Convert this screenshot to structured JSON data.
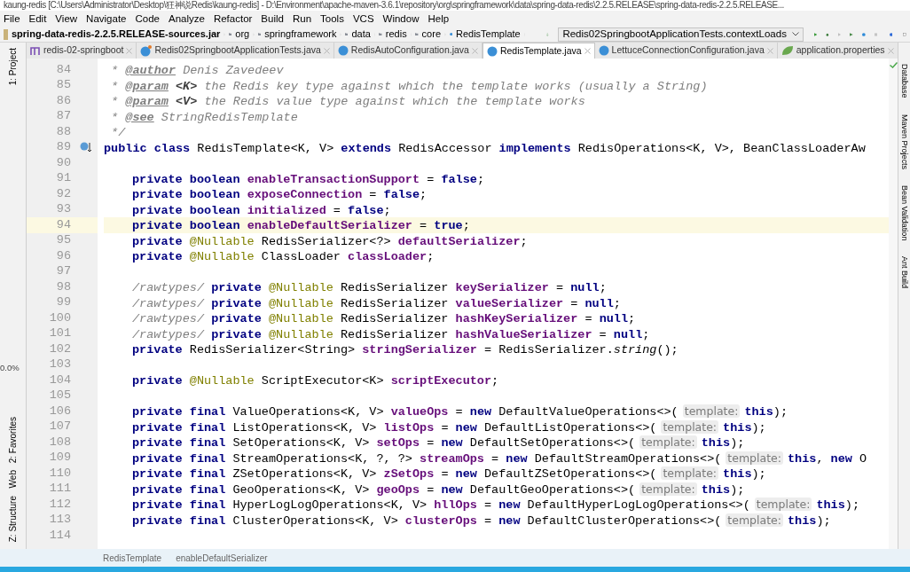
{
  "window": {
    "title": "kaung-redis [C:\\Users\\Administrator\\Desktop\\狂神说Redis\\kaung-redis] - D:\\Environment\\apache-maven-3.6.1\\repository\\org\\springframework\\data\\spring-data-redis\\2.2.5.RELEASE\\spring-data-redis-2.2.5.RELEASE..."
  },
  "menu": [
    "File",
    "Edit",
    "View",
    "Navigate",
    "Code",
    "Analyze",
    "Refactor",
    "Build",
    "Run",
    "Tools",
    "VCS",
    "Window",
    "Help"
  ],
  "breadcrumb": [
    {
      "label": "spring-data-redis-2.2.5.RELEASE-sources.jar",
      "kind": "jar"
    },
    {
      "label": "org",
      "kind": "folder"
    },
    {
      "label": "springframework",
      "kind": "folder"
    },
    {
      "label": "data",
      "kind": "folder"
    },
    {
      "label": "redis",
      "kind": "folder"
    },
    {
      "label": "core",
      "kind": "folder"
    },
    {
      "label": "RedisTemplate",
      "kind": "class"
    }
  ],
  "run_config": {
    "value": "Redis02SpringbootApplicationTests.contextLoads"
  },
  "tabs": [
    {
      "label": "redis-02-springboot",
      "kind": "module",
      "selected": false
    },
    {
      "label": "Redis02SpringbootApplicationTests.java",
      "kind": "test",
      "selected": false
    },
    {
      "label": "RedisAutoConfiguration.java",
      "kind": "class",
      "selected": false
    },
    {
      "label": "RedisTemplate.java",
      "kind": "class",
      "selected": true
    },
    {
      "label": "LettuceConnectionConfiguration.java",
      "kind": "class",
      "selected": false
    },
    {
      "label": "application.properties",
      "kind": "properties",
      "selected": false
    }
  ],
  "left_tools": [
    "1: Project",
    "2: Favorites",
    "Web",
    "Z: Structure"
  ],
  "right_tools": [
    "Database",
    "Maven Projects",
    "Bean Validation",
    "Ant Build"
  ],
  "overlay": {
    "reading": "0.0%"
  },
  "code": [
    {
      "number": "84",
      "kind": "top",
      "current": false,
      "tokens": [
        {
          "t": " * ",
          "kind": "comment"
        },
        {
          "t": "@author",
          "kind": "doctag"
        },
        {
          "t": " Denis Zavedeev",
          "kind": "comment"
        }
      ]
    },
    {
      "number": "85",
      "kind": "top",
      "current": false,
      "tokens": [
        {
          "t": " * ",
          "kind": "comment"
        },
        {
          "t": "@param",
          "kind": "doctag"
        },
        {
          "t": " <K>",
          "kind": "docparam"
        },
        {
          "t": " the Redis key type against which the template works (usually a String)",
          "kind": "comment"
        }
      ]
    },
    {
      "number": "86",
      "kind": "top",
      "current": false,
      "tokens": [
        {
          "t": " * ",
          "kind": "comment"
        },
        {
          "t": "@param",
          "kind": "doctag"
        },
        {
          "t": " <V>",
          "kind": "docparam"
        },
        {
          "t": " the Redis value type against which the template works",
          "kind": "comment"
        }
      ]
    },
    {
      "number": "87",
      "kind": "top",
      "current": false,
      "tokens": [
        {
          "t": " * ",
          "kind": "comment"
        },
        {
          "t": "@see",
          "kind": "doctag"
        },
        {
          "t": " StringRedisTemplate",
          "kind": "commentref"
        }
      ]
    },
    {
      "number": "88",
      "kind": "top",
      "current": false,
      "tokens": [
        {
          "t": " */",
          "kind": "comment"
        }
      ]
    },
    {
      "number": "89",
      "kind": "top",
      "current": false,
      "tokens": [
        {
          "t": "public class ",
          "kind": "kw"
        },
        {
          "t": "RedisTemplate<K, V> ",
          "kind": "plain"
        },
        {
          "t": "extends ",
          "kind": "kw"
        },
        {
          "t": "RedisAccessor ",
          "kind": "plain"
        },
        {
          "t": "implements ",
          "kind": "kw"
        },
        {
          "t": "RedisOperations<K, V>, BeanClassLoaderAw",
          "kind": "plain"
        }
      ]
    },
    {
      "number": "90",
      "current": false
    },
    {
      "number": "91",
      "kind": "member",
      "current": false,
      "tokens": [
        {
          "t": "private boolean ",
          "kind": "kw"
        },
        {
          "t": "enableTransactionSupport",
          "kind": "field"
        },
        {
          "t": " = ",
          "kind": "plain"
        },
        {
          "t": "false",
          "kind": "kw"
        },
        {
          "t": ";",
          "kind": "plain"
        }
      ]
    },
    {
      "number": "92",
      "kind": "member",
      "current": false,
      "tokens": [
        {
          "t": "private boolean ",
          "kind": "kw"
        },
        {
          "t": "exposeConnection",
          "kind": "field"
        },
        {
          "t": " = ",
          "kind": "plain"
        },
        {
          "t": "false",
          "kind": "kw"
        },
        {
          "t": ";",
          "kind": "plain"
        }
      ]
    },
    {
      "number": "93",
      "kind": "member",
      "current": false,
      "tokens": [
        {
          "t": "private boolean ",
          "kind": "kw"
        },
        {
          "t": "initialized",
          "kind": "field"
        },
        {
          "t": " = ",
          "kind": "plain"
        },
        {
          "t": "false",
          "kind": "kw"
        },
        {
          "t": ";",
          "kind": "plain"
        }
      ]
    },
    {
      "number": "94",
      "kind": "member",
      "current": true,
      "tokens": [
        {
          "t": "private boolean ",
          "kind": "kw"
        },
        {
          "t": "enableDefaultSerializer",
          "kind": "field"
        },
        {
          "t": " = ",
          "kind": "plain"
        },
        {
          "t": "true",
          "kind": "kw"
        },
        {
          "t": ";",
          "kind": "plain"
        }
      ]
    },
    {
      "number": "95",
      "kind": "member",
      "current": false,
      "tokens": [
        {
          "t": "private ",
          "kind": "kw"
        },
        {
          "t": "@Nullable ",
          "kind": "ann"
        },
        {
          "t": "RedisSerializer<?> ",
          "kind": "plain"
        },
        {
          "t": "defaultSerializer",
          "kind": "field"
        },
        {
          "t": ";",
          "kind": "plain"
        }
      ]
    },
    {
      "number": "96",
      "kind": "member",
      "current": false,
      "tokens": [
        {
          "t": "private ",
          "kind": "kw"
        },
        {
          "t": "@Nullable ",
          "kind": "ann"
        },
        {
          "t": "ClassLoader ",
          "kind": "plain"
        },
        {
          "t": "classLoader",
          "kind": "field"
        },
        {
          "t": ";",
          "kind": "plain"
        }
      ]
    },
    {
      "number": "97",
      "current": false
    },
    {
      "number": "98",
      "kind": "member",
      "current": false,
      "tokens": [
        {
          "t": "/rawtypes/ ",
          "kind": "comment"
        },
        {
          "t": "private ",
          "kind": "kw"
        },
        {
          "t": "@Nullable ",
          "kind": "ann"
        },
        {
          "t": "RedisSerializer ",
          "kind": "plain"
        },
        {
          "t": "keySerializer",
          "kind": "field"
        },
        {
          "t": " = ",
          "kind": "plain"
        },
        {
          "t": "null",
          "kind": "kw"
        },
        {
          "t": ";",
          "kind": "plain"
        }
      ]
    },
    {
      "number": "99",
      "kind": "member",
      "current": false,
      "tokens": [
        {
          "t": "/rawtypes/ ",
          "kind": "comment"
        },
        {
          "t": "private ",
          "kind": "kw"
        },
        {
          "t": "@Nullable ",
          "kind": "ann"
        },
        {
          "t": "RedisSerializer ",
          "kind": "plain"
        },
        {
          "t": "valueSerializer",
          "kind": "field"
        },
        {
          "t": " = ",
          "kind": "plain"
        },
        {
          "t": "null",
          "kind": "kw"
        },
        {
          "t": ";",
          "kind": "plain"
        }
      ]
    },
    {
      "number": "100",
      "kind": "member",
      "current": false,
      "tokens": [
        {
          "t": "/rawtypes/ ",
          "kind": "comment"
        },
        {
          "t": "private ",
          "kind": "kw"
        },
        {
          "t": "@Nullable ",
          "kind": "ann"
        },
        {
          "t": "RedisSerializer ",
          "kind": "plain"
        },
        {
          "t": "hashKeySerializer",
          "kind": "field"
        },
        {
          "t": " = ",
          "kind": "plain"
        },
        {
          "t": "null",
          "kind": "kw"
        },
        {
          "t": ";",
          "kind": "plain"
        }
      ]
    },
    {
      "number": "101",
      "kind": "member",
      "current": false,
      "tokens": [
        {
          "t": "/rawtypes/ ",
          "kind": "comment"
        },
        {
          "t": "private ",
          "kind": "kw"
        },
        {
          "t": "@Nullable ",
          "kind": "ann"
        },
        {
          "t": "RedisSerializer ",
          "kind": "plain"
        },
        {
          "t": "hashValueSerializer",
          "kind": "field"
        },
        {
          "t": " = ",
          "kind": "plain"
        },
        {
          "t": "null",
          "kind": "kw"
        },
        {
          "t": ";",
          "kind": "plain"
        }
      ]
    },
    {
      "number": "102",
      "kind": "member",
      "current": false,
      "tokens": [
        {
          "t": "private ",
          "kind": "kw"
        },
        {
          "t": "RedisSerializer<String> ",
          "kind": "plain"
        },
        {
          "t": "stringSerializer",
          "kind": "field"
        },
        {
          "t": " = RedisSerializer.",
          "kind": "plain"
        },
        {
          "t": "string",
          "kind": "static"
        },
        {
          "t": "();",
          "kind": "plain"
        }
      ]
    },
    {
      "number": "103",
      "current": false
    },
    {
      "number": "104",
      "kind": "member",
      "current": false,
      "tokens": [
        {
          "t": "private ",
          "kind": "kw"
        },
        {
          "t": "@Nullable ",
          "kind": "ann"
        },
        {
          "t": "ScriptExecutor<K> ",
          "kind": "plain"
        },
        {
          "t": "scriptExecutor",
          "kind": "field"
        },
        {
          "t": ";",
          "kind": "plain"
        }
      ]
    },
    {
      "number": "105",
      "current": false
    },
    {
      "number": "106",
      "kind": "member",
      "current": false,
      "tokens": [
        {
          "t": "private final ",
          "kind": "kw"
        },
        {
          "t": "ValueOperations<K, V> ",
          "kind": "plain"
        },
        {
          "t": "valueOps",
          "kind": "field"
        },
        {
          "t": " = ",
          "kind": "plain"
        },
        {
          "t": "new ",
          "kind": "kw"
        },
        {
          "t": "DefaultValueOperations<>(",
          "kind": "plain"
        },
        {
          "t": "template:",
          "kind": "hint"
        },
        {
          "t": "this",
          "kind": "kw"
        },
        {
          "t": ");",
          "kind": "plain"
        }
      ]
    },
    {
      "number": "107",
      "kind": "member",
      "current": false,
      "tokens": [
        {
          "t": "private final ",
          "kind": "kw"
        },
        {
          "t": "ListOperations<K, V> ",
          "kind": "plain"
        },
        {
          "t": "listOps",
          "kind": "field"
        },
        {
          "t": " = ",
          "kind": "plain"
        },
        {
          "t": "new ",
          "kind": "kw"
        },
        {
          "t": "DefaultListOperations<>(",
          "kind": "plain"
        },
        {
          "t": "template:",
          "kind": "hint"
        },
        {
          "t": "this",
          "kind": "kw"
        },
        {
          "t": ");",
          "kind": "plain"
        }
      ]
    },
    {
      "number": "108",
      "kind": "member",
      "current": false,
      "tokens": [
        {
          "t": "private final ",
          "kind": "kw"
        },
        {
          "t": "SetOperations<K, V> ",
          "kind": "plain"
        },
        {
          "t": "setOps",
          "kind": "field"
        },
        {
          "t": " = ",
          "kind": "plain"
        },
        {
          "t": "new ",
          "kind": "kw"
        },
        {
          "t": "DefaultSetOperations<>(",
          "kind": "plain"
        },
        {
          "t": "template:",
          "kind": "hint"
        },
        {
          "t": "this",
          "kind": "kw"
        },
        {
          "t": ");",
          "kind": "plain"
        }
      ]
    },
    {
      "number": "109",
      "kind": "member",
      "current": false,
      "tokens": [
        {
          "t": "private final ",
          "kind": "kw"
        },
        {
          "t": "StreamOperations<K, ?, ?> ",
          "kind": "plain"
        },
        {
          "t": "streamOps",
          "kind": "field"
        },
        {
          "t": " = ",
          "kind": "plain"
        },
        {
          "t": "new ",
          "kind": "kw"
        },
        {
          "t": "DefaultStreamOperations<>(",
          "kind": "plain"
        },
        {
          "t": "template:",
          "kind": "hint"
        },
        {
          "t": "this",
          "kind": "kw"
        },
        {
          "t": ", ",
          "kind": "plain"
        },
        {
          "t": "new ",
          "kind": "kw"
        },
        {
          "t": "O",
          "kind": "plain"
        }
      ]
    },
    {
      "number": "110",
      "kind": "member",
      "current": false,
      "tokens": [
        {
          "t": "private final ",
          "kind": "kw"
        },
        {
          "t": "ZSetOperations<K, V> ",
          "kind": "plain"
        },
        {
          "t": "zSetOps",
          "kind": "field"
        },
        {
          "t": " = ",
          "kind": "plain"
        },
        {
          "t": "new ",
          "kind": "kw"
        },
        {
          "t": "DefaultZSetOperations<>(",
          "kind": "plain"
        },
        {
          "t": "template:",
          "kind": "hint"
        },
        {
          "t": "this",
          "kind": "kw"
        },
        {
          "t": ");",
          "kind": "plain"
        }
      ]
    },
    {
      "number": "111",
      "kind": "member",
      "current": false,
      "tokens": [
        {
          "t": "private final ",
          "kind": "kw"
        },
        {
          "t": "GeoOperations<K, V> ",
          "kind": "plain"
        },
        {
          "t": "geoOps",
          "kind": "field"
        },
        {
          "t": " = ",
          "kind": "plain"
        },
        {
          "t": "new ",
          "kind": "kw"
        },
        {
          "t": "DefaultGeoOperations<>(",
          "kind": "plain"
        },
        {
          "t": "template:",
          "kind": "hint"
        },
        {
          "t": "this",
          "kind": "kw"
        },
        {
          "t": ");",
          "kind": "plain"
        }
      ]
    },
    {
      "number": "112",
      "kind": "member",
      "current": false,
      "tokens": [
        {
          "t": "private final ",
          "kind": "kw"
        },
        {
          "t": "HyperLogLogOperations<K, V> ",
          "kind": "plain"
        },
        {
          "t": "hllOps",
          "kind": "field"
        },
        {
          "t": " = ",
          "kind": "plain"
        },
        {
          "t": "new ",
          "kind": "kw"
        },
        {
          "t": "DefaultHyperLogLogOperations<>(",
          "kind": "plain"
        },
        {
          "t": "template:",
          "kind": "hint"
        },
        {
          "t": "this",
          "kind": "kw"
        },
        {
          "t": ");",
          "kind": "plain"
        }
      ]
    },
    {
      "number": "113",
      "kind": "member",
      "current": false,
      "tokens": [
        {
          "t": "private final ",
          "kind": "kw"
        },
        {
          "t": "ClusterOperations<K, V> ",
          "kind": "plain"
        },
        {
          "t": "clusterOps",
          "kind": "field"
        },
        {
          "t": " = ",
          "kind": "plain"
        },
        {
          "t": "new ",
          "kind": "kw"
        },
        {
          "t": "DefaultClusterOperations<>(",
          "kind": "plain"
        },
        {
          "t": "template:",
          "kind": "hint"
        },
        {
          "t": "this",
          "kind": "kw"
        },
        {
          "t": ");",
          "kind": "plain"
        }
      ]
    },
    {
      "number": "114",
      "current": false
    }
  ],
  "status_breadcrumb": [
    "RedisTemplate",
    "enableDefaultSerializer"
  ]
}
